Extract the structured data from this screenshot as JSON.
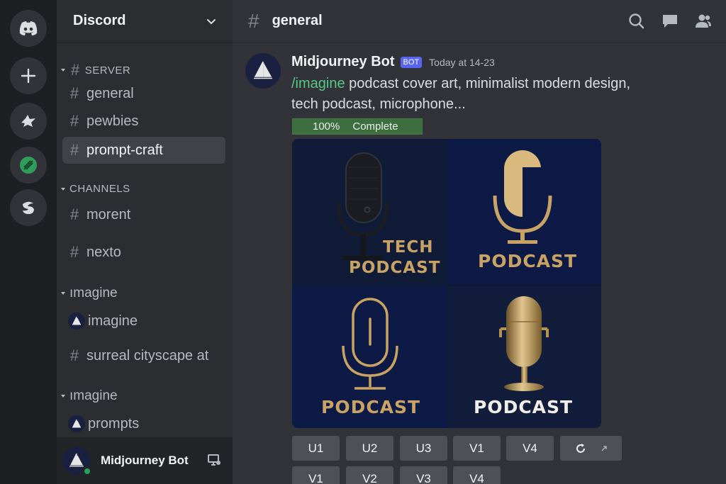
{
  "server_rail": {
    "items": [
      "discord-home",
      "add-server",
      "server-1",
      "server-2",
      "server-3"
    ]
  },
  "sidebar": {
    "guild_name": "Discord",
    "categories": [
      "SERVER",
      "CHANNELS",
      "ımagine",
      "ımagine"
    ],
    "channels": {
      "general": "general",
      "pewbies": "pewbies",
      "prompt_craft": "prompt-craft",
      "morent": "morent",
      "nexto": "nexto",
      "imagine": "imagine",
      "surreal": "surreal cityscape at",
      "prompts": "prompts"
    }
  },
  "user_panel": {
    "name": "Midjourney Bot",
    "status_color": "#23a55a"
  },
  "topbar": {
    "channel": "general",
    "icons": [
      "search-icon",
      "threads-icon",
      "members-icon"
    ]
  },
  "message": {
    "author": "Midjourney Bot",
    "badge": "BOT",
    "timestamp": "Today at 14-23",
    "command": "/imagine",
    "prompt_line1": " podcast cover art, minimalist modern design,",
    "prompt_line2": "tech podcast, microphone...",
    "progress_pct": "100%",
    "progress_label": "Complete",
    "progress_value": 1.0
  },
  "images": {
    "q1_line1": "TECH",
    "q1_line2": "PODCAST",
    "q2": "PODCAST",
    "q3": "PODCAST",
    "q4": "PODCAST"
  },
  "buttons": {
    "row1": [
      "U1",
      "U2",
      "U3",
      "V1",
      "V4"
    ],
    "row2": [
      "V1",
      "V2",
      "V3",
      "V4"
    ]
  },
  "colors": {
    "accent": "#5865f2",
    "command": "#57c785",
    "gold": "#c9a363"
  }
}
